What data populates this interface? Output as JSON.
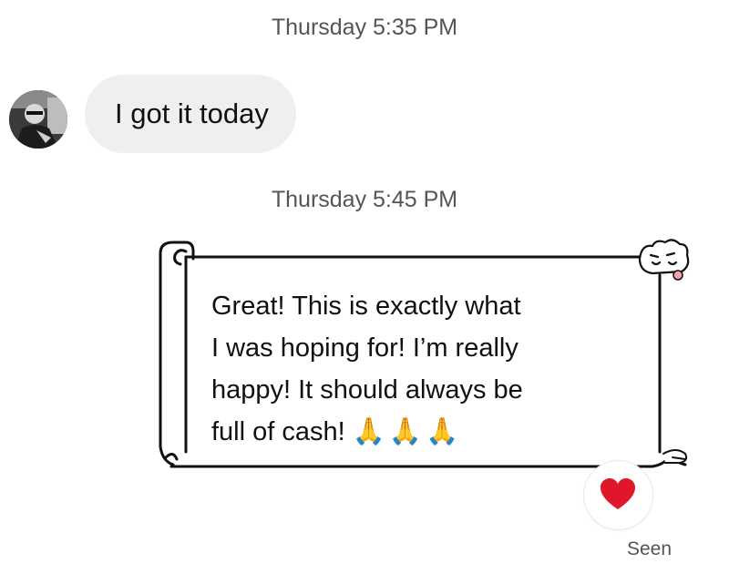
{
  "thread": {
    "timestamp_1": "Thursday 5:35 PM",
    "incoming_message": "I got it today",
    "timestamp_2": "Thursday 5:45 PM",
    "outgoing_message": {
      "line_1": "Great! This is exactly what",
      "line_2": "I was hoping for! I’m really",
      "line_3": "happy! It should always be",
      "line_4": "full of cash!",
      "emoji": "🙏🙏🙏"
    },
    "reaction_icon": "heart-icon",
    "seen_label": "Seen"
  },
  "colors": {
    "incoming_bubble": "#efefef",
    "timestamp_text": "#555555",
    "reaction_heart": "#e0162b"
  }
}
